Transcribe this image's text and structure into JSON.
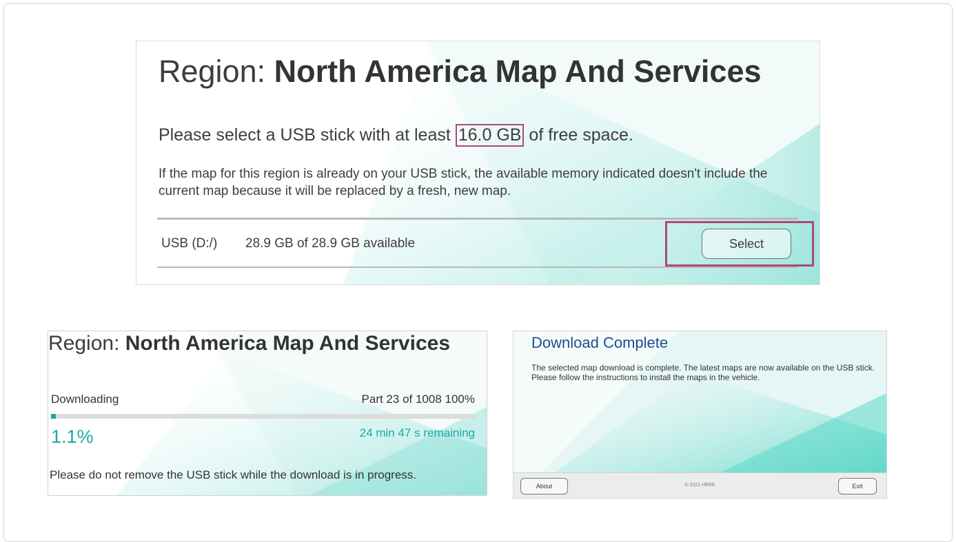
{
  "top_panel": {
    "title_prefix": "Region: ",
    "title_region": "North America Map And Services",
    "requirement_prefix": "Please select a USB stick with at least ",
    "required_space": "16.0 GB",
    "requirement_suffix": " of free space.",
    "note": "If the map for this region is already on your USB stick, the available memory indicated doesn't include the current map because it will be replaced by a fresh, new map.",
    "drive_label": "USB (D:/)",
    "drive_space": "28.9 GB of 28.9 GB available",
    "select_label": "Select"
  },
  "download_panel": {
    "title_prefix": "Region: ",
    "title_region": "North America Map And Services",
    "status": "Downloading",
    "parts": "Part 23 of 1008  100%",
    "progress_percent": "1.1%",
    "progress_fraction": 0.011,
    "remaining": "24 min 47 s remaining",
    "warning": "Please do not remove the USB stick while the download is in progress."
  },
  "complete_panel": {
    "title": "Download Complete",
    "body": "The selected map download is complete. The latest maps are now available on the USB stick. Please follow the instructions to install the maps in the vehicle.",
    "about_label": "About",
    "copyright": "© 2021 HERE",
    "exit_label": "Exit"
  },
  "colors": {
    "accent_teal": "#1ba8a7",
    "highlight_magenta": "#b0457f",
    "title_blue": "#1d4d8c"
  }
}
